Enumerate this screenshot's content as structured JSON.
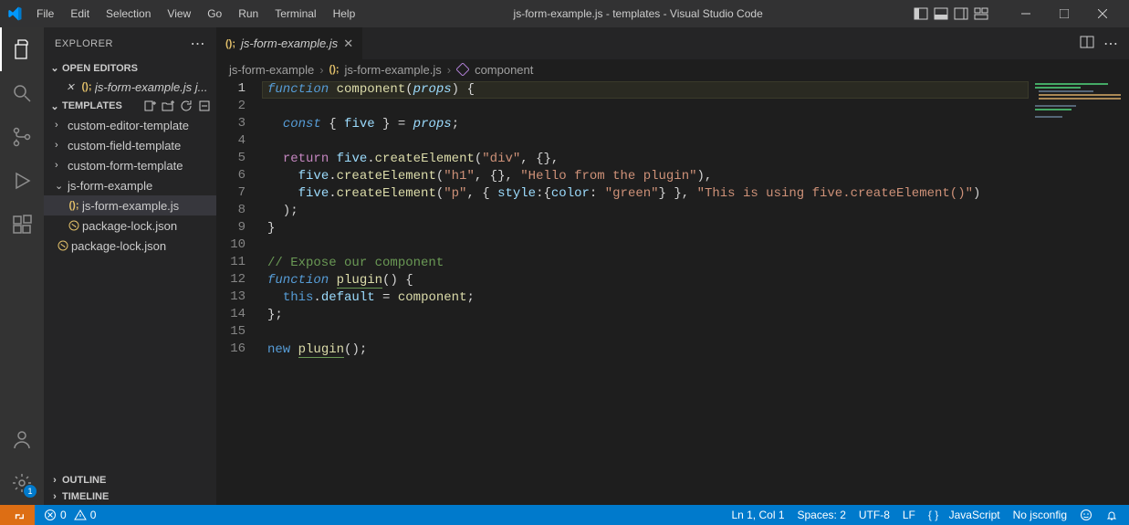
{
  "titlebar": {
    "title": "js-form-example.js - templates - Visual Studio Code",
    "menu": [
      "File",
      "Edit",
      "Selection",
      "View",
      "Go",
      "Run",
      "Terminal",
      "Help"
    ]
  },
  "sidebar": {
    "header": "EXPLORER",
    "open_editors": "OPEN EDITORS",
    "open_editor_item": "js-form-example.js  j...",
    "workspace": "TEMPLATES",
    "items": [
      {
        "label": "custom-editor-template",
        "kind": "folder",
        "depth": 0
      },
      {
        "label": "custom-field-template",
        "kind": "folder",
        "depth": 0
      },
      {
        "label": "custom-form-template",
        "kind": "folder",
        "depth": 0
      },
      {
        "label": "js-form-example",
        "kind": "folder-open",
        "depth": 0
      },
      {
        "label": "js-form-example.js",
        "kind": "js",
        "depth": 1,
        "selected": true
      },
      {
        "label": "package-lock.json",
        "kind": "json",
        "depth": 1
      },
      {
        "label": "package-lock.json",
        "kind": "json",
        "depth": 0
      }
    ],
    "outline": "OUTLINE",
    "timeline": "TIMELINE"
  },
  "tab": {
    "label": "js-form-example.js"
  },
  "breadcrumb": {
    "seg1": "js-form-example",
    "seg2": "js-form-example.js",
    "seg3": "component"
  },
  "statusbar": {
    "errors": "0",
    "warnings": "0",
    "ln": "Ln 1, Col 1",
    "spaces": "Spaces: 2",
    "enc": "UTF-8",
    "eol": "LF",
    "lang": "JavaScript",
    "jsconfig": "No jsconfig"
  },
  "code": {
    "current_line": 1,
    "lines": [
      [
        {
          "c": "k-blue",
          "t": "function"
        },
        {
          "c": "pun",
          "t": " "
        },
        {
          "c": "fn",
          "t": "component"
        },
        {
          "c": "pun",
          "t": "("
        },
        {
          "c": "param",
          "t": "props"
        },
        {
          "c": "pun",
          "t": ") {"
        }
      ],
      [],
      [
        {
          "c": "pun",
          "t": "  "
        },
        {
          "c": "k-blue",
          "t": "const"
        },
        {
          "c": "pun",
          "t": " { "
        },
        {
          "c": "var",
          "t": "five"
        },
        {
          "c": "pun",
          "t": " } = "
        },
        {
          "c": "param",
          "t": "props"
        },
        {
          "c": "pun",
          "t": ";"
        }
      ],
      [],
      [
        {
          "c": "pun",
          "t": "  "
        },
        {
          "c": "ret",
          "t": "return"
        },
        {
          "c": "pun",
          "t": " "
        },
        {
          "c": "var",
          "t": "five"
        },
        {
          "c": "pun",
          "t": "."
        },
        {
          "c": "fn",
          "t": "createElement"
        },
        {
          "c": "pun",
          "t": "("
        },
        {
          "c": "str",
          "t": "\"div\""
        },
        {
          "c": "pun",
          "t": ", {},"
        }
      ],
      [
        {
          "c": "pun",
          "t": "    "
        },
        {
          "c": "var",
          "t": "five"
        },
        {
          "c": "pun",
          "t": "."
        },
        {
          "c": "fn",
          "t": "createElement"
        },
        {
          "c": "pun",
          "t": "("
        },
        {
          "c": "str",
          "t": "\"h1\""
        },
        {
          "c": "pun",
          "t": ", {}, "
        },
        {
          "c": "str",
          "t": "\"Hello from the plugin\""
        },
        {
          "c": "pun",
          "t": "),"
        }
      ],
      [
        {
          "c": "pun",
          "t": "    "
        },
        {
          "c": "var",
          "t": "five"
        },
        {
          "c": "pun",
          "t": "."
        },
        {
          "c": "fn",
          "t": "createElement"
        },
        {
          "c": "pun",
          "t": "("
        },
        {
          "c": "str",
          "t": "\"p\""
        },
        {
          "c": "pun",
          "t": ", { "
        },
        {
          "c": "var",
          "t": "style"
        },
        {
          "c": "pun",
          "t": ":{"
        },
        {
          "c": "var",
          "t": "color"
        },
        {
          "c": "pun",
          "t": ": "
        },
        {
          "c": "str",
          "t": "\"green\""
        },
        {
          "c": "pun",
          "t": "} }, "
        },
        {
          "c": "str",
          "t": "\"This is using five.createElement()\""
        },
        {
          "c": "pun",
          "t": ")"
        }
      ],
      [
        {
          "c": "pun",
          "t": "  );"
        }
      ],
      [
        {
          "c": "pun",
          "t": "}"
        }
      ],
      [],
      [
        {
          "c": "cmt",
          "t": "// Expose our component"
        }
      ],
      [
        {
          "c": "k-blue",
          "t": "function"
        },
        {
          "c": "pun",
          "t": " "
        },
        {
          "c": "fn underline",
          "t": "plugin"
        },
        {
          "c": "pun",
          "t": "() {"
        }
      ],
      [
        {
          "c": "pun",
          "t": "  "
        },
        {
          "c": "this",
          "t": "this"
        },
        {
          "c": "pun",
          "t": "."
        },
        {
          "c": "var",
          "t": "default"
        },
        {
          "c": "pun",
          "t": " = "
        },
        {
          "c": "fn",
          "t": "component"
        },
        {
          "c": "pun",
          "t": ";"
        }
      ],
      [
        {
          "c": "pun",
          "t": "};"
        }
      ],
      [],
      [
        {
          "c": "kw-new",
          "t": "new"
        },
        {
          "c": "pun",
          "t": " "
        },
        {
          "c": "fn underline",
          "t": "plugin"
        },
        {
          "c": "pun",
          "t": "();"
        }
      ]
    ]
  }
}
